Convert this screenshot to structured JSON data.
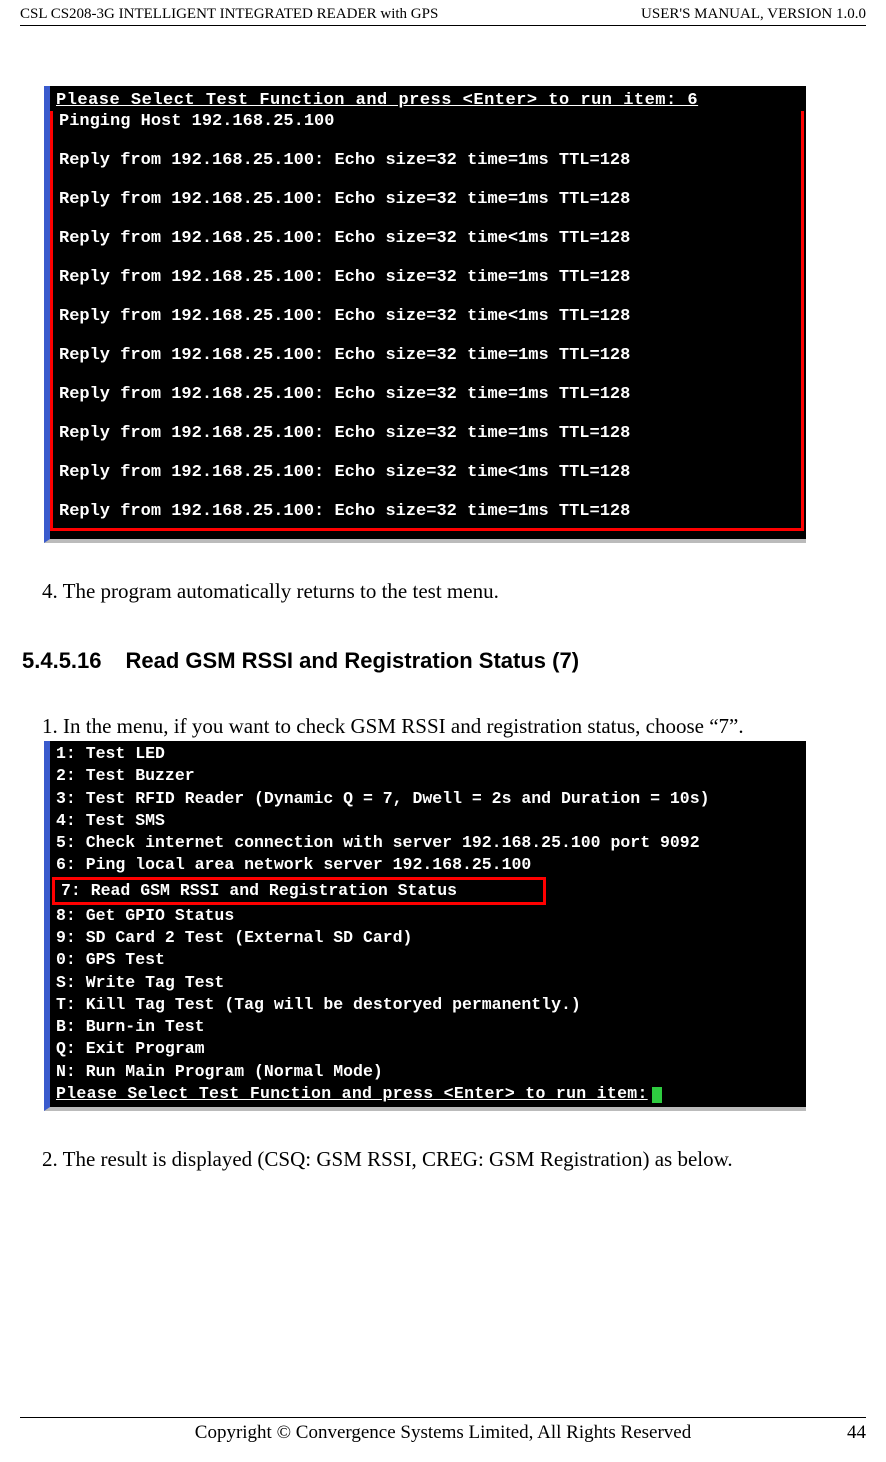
{
  "header": {
    "left": "CSL CS208-3G INTELLIGENT INTEGRATED READER with GPS",
    "right": "USER'S  MANUAL,  VERSION  1.0.0"
  },
  "footer": {
    "center": "Copyright © Convergence Systems Limited, All Rights Reserved",
    "page": "44"
  },
  "term1": {
    "prompt": "Please Select Test Function and press <Enter> to run item: 6",
    "lines": [
      "Pinging Host 192.168.25.100",
      "",
      "Reply from 192.168.25.100: Echo size=32 time=1ms TTL=128",
      "",
      "Reply from 192.168.25.100: Echo size=32 time=1ms TTL=128",
      "",
      "Reply from 192.168.25.100: Echo size=32 time<1ms TTL=128",
      "",
      "Reply from 192.168.25.100: Echo size=32 time=1ms TTL=128",
      "",
      "Reply from 192.168.25.100: Echo size=32 time<1ms TTL=128",
      "",
      "Reply from 192.168.25.100: Echo size=32 time=1ms TTL=128",
      "",
      "Reply from 192.168.25.100: Echo size=32 time=1ms TTL=128",
      "",
      "Reply from 192.168.25.100: Echo size=32 time=1ms TTL=128",
      "",
      "Reply from 192.168.25.100: Echo size=32 time<1ms TTL=128",
      "",
      "Reply from 192.168.25.100: Echo size=32 time=1ms TTL=128"
    ]
  },
  "para4": "4. The program automatically returns to the test menu.",
  "section": {
    "num": "5.4.5.16",
    "title": "Read GSM RSSI and Registration Status (7)"
  },
  "para1b": "1. In the menu, if you want to check GSM RSSI and registration status, choose “7”.",
  "term2": {
    "lines_before": [
      "1: Test LED",
      "2: Test Buzzer",
      "3: Test RFID Reader (Dynamic Q = 7, Dwell = 2s and Duration = 10s)",
      "4: Test SMS",
      "5: Check internet connection with server 192.168.25.100 port 9092",
      "6: Ping local area network server 192.168.25.100"
    ],
    "highlight": "7: Read GSM RSSI and Registration Status",
    "lines_after": [
      "8: Get GPIO Status",
      "9: SD Card 2 Test (External SD Card)",
      "0: GPS Test",
      "S: Write Tag Test",
      "T: Kill Tag Test (Tag will be destoryed permanently.)",
      "",
      "B: Burn-in Test",
      "Q: Exit Program",
      "N: Run Main Program (Normal Mode)"
    ],
    "prompt": "Please Select Test Function and press <Enter> to run item:"
  },
  "para2b": "2. The result is displayed (CSQ: GSM RSSI, CREG: GSM Registration) as below."
}
